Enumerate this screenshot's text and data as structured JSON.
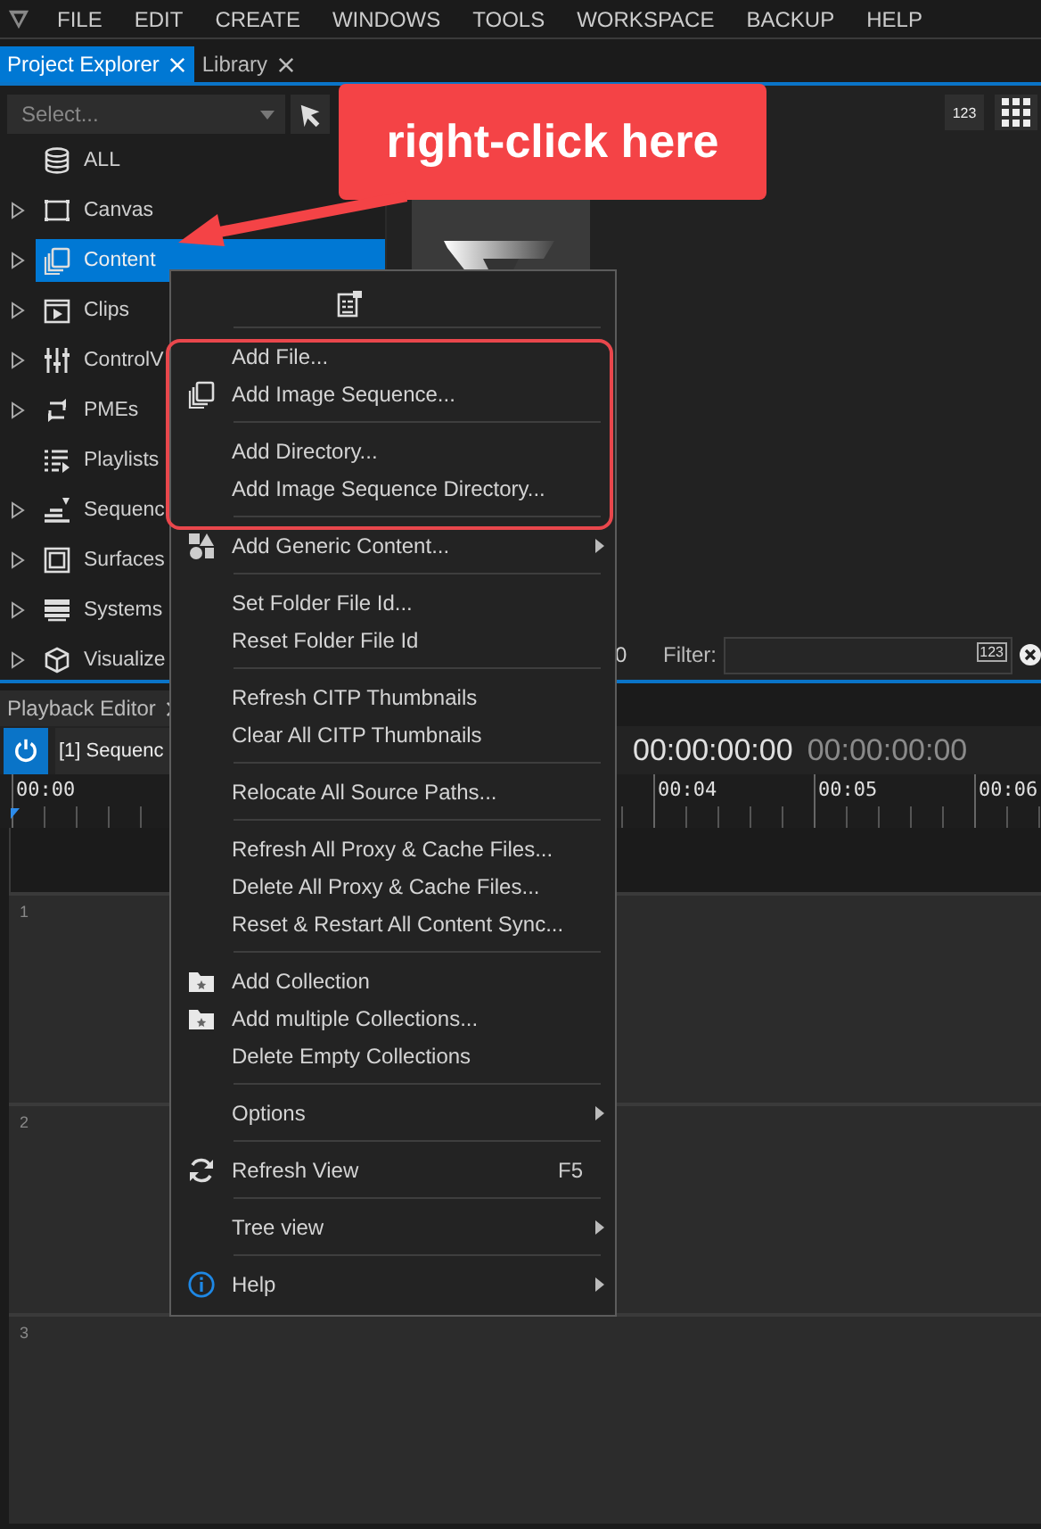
{
  "menu_bar": {
    "items": [
      "FILE",
      "EDIT",
      "CREATE",
      "WINDOWS",
      "TOOLS",
      "WORKSPACE",
      "BACKUP",
      "HELP"
    ]
  },
  "top_tabs": [
    {
      "label": "Project Explorer",
      "selected": true
    },
    {
      "label": "Library",
      "selected": false
    }
  ],
  "explorer": {
    "select": {
      "placeholder": "Select..."
    },
    "sort_button": "123",
    "tree": [
      {
        "label": "ALL",
        "expandable": false,
        "selected": false
      },
      {
        "label": "Canvas",
        "expandable": true,
        "expanded": false,
        "selected": false
      },
      {
        "label": "Content",
        "expandable": true,
        "expanded": false,
        "selected": true
      },
      {
        "label": "Clips",
        "expandable": true,
        "expanded": false,
        "selected": false
      },
      {
        "label": "ControlV",
        "expandable": true,
        "expanded": false,
        "selected": false
      },
      {
        "label": "PMEs",
        "expandable": true,
        "expanded": false,
        "selected": false
      },
      {
        "label": "Playlists",
        "expandable": false,
        "selected": false
      },
      {
        "label": "Sequenc",
        "expandable": true,
        "expanded": false,
        "selected": false
      },
      {
        "label": "Surfaces",
        "expandable": true,
        "expanded": false,
        "selected": false
      },
      {
        "label": "Systems",
        "expandable": true,
        "expanded": false,
        "selected": false
      },
      {
        "label": "Visualize",
        "expandable": true,
        "expanded": false,
        "selected": false
      }
    ],
    "count": "0",
    "filter": {
      "label": "Filter:",
      "badge": "123"
    }
  },
  "playback_editor": {
    "tab": "Playback Editor",
    "power": {
      "on": true
    },
    "sequence": "[1] Sequenc",
    "timecode": "00:00:00:00",
    "duration": "00:00:00:00",
    "ruler": [
      "00:00",
      "00:04",
      "00:05",
      "00:06"
    ],
    "tracks": [
      "1",
      "2",
      "3"
    ]
  },
  "context_menu": {
    "groups": [
      {
        "items": [
          {
            "label": "Add File...",
            "submenu": false
          },
          {
            "label": "Add Image Sequence...",
            "submenu": false
          }
        ]
      },
      {
        "items": [
          {
            "label": "Add Directory...",
            "submenu": false
          },
          {
            "label": "Add Image Sequence Directory...",
            "submenu": false
          }
        ]
      },
      {
        "items": [
          {
            "label": "Add Generic Content...",
            "submenu": true
          }
        ]
      },
      {
        "items": [
          {
            "label": "Set Folder File Id...",
            "submenu": false
          },
          {
            "label": "Reset Folder File Id",
            "submenu": false
          }
        ]
      },
      {
        "items": [
          {
            "label": "Refresh CITP Thumbnails",
            "submenu": false
          },
          {
            "label": "Clear All CITP Thumbnails",
            "submenu": false
          }
        ]
      },
      {
        "items": [
          {
            "label": "Relocate All Source Paths...",
            "submenu": false
          }
        ]
      },
      {
        "items": [
          {
            "label": "Refresh All Proxy & Cache Files...",
            "submenu": false
          },
          {
            "label": "Delete All Proxy & Cache Files...",
            "submenu": false
          },
          {
            "label": "Reset & Restart All Content Sync...",
            "submenu": false
          }
        ]
      },
      {
        "items": [
          {
            "label": "Add Collection",
            "submenu": false
          },
          {
            "label": "Add multiple Collections...",
            "submenu": false
          },
          {
            "label": "Delete Empty Collections",
            "submenu": false
          }
        ]
      },
      {
        "items": [
          {
            "label": "Options",
            "submenu": true
          }
        ]
      },
      {
        "items": [
          {
            "label": "Refresh View",
            "submenu": false,
            "shortcut": "F5"
          }
        ]
      },
      {
        "items": [
          {
            "label": "Tree view",
            "submenu": true
          }
        ]
      },
      {
        "items": [
          {
            "label": "Help",
            "submenu": true
          }
        ]
      }
    ]
  },
  "callout": {
    "text": "right-click here"
  }
}
